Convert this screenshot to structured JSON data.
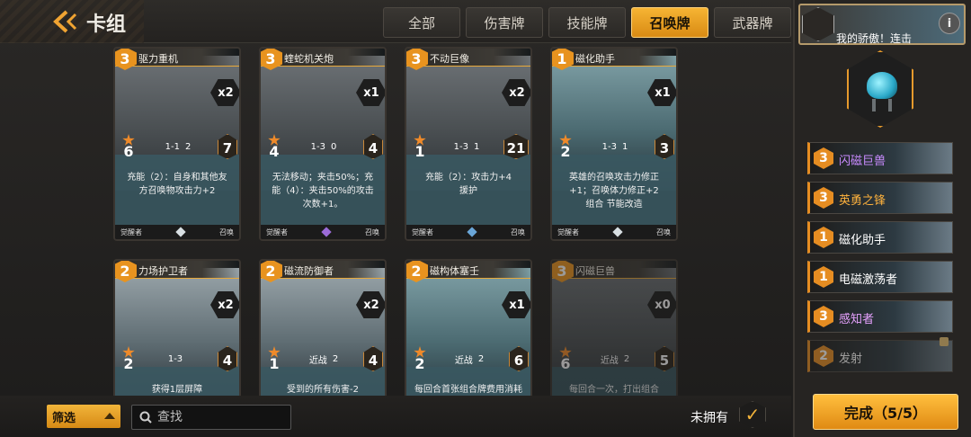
{
  "header": {
    "title": "卡组"
  },
  "tabs": [
    {
      "label": "全部",
      "active": false
    },
    {
      "label": "伤害牌",
      "active": false
    },
    {
      "label": "技能牌",
      "active": false
    },
    {
      "label": "召唤牌",
      "active": true
    },
    {
      "label": "武器牌",
      "active": false
    }
  ],
  "cards": [
    {
      "cost": "3",
      "name": "驱力重机",
      "mult": "x2",
      "atk": "6",
      "range": "1-1",
      "mid": "2",
      "hp": "7",
      "desc": [
        "充能（2）：自身和其他友",
        "方召唤物攻击力+2"
      ],
      "desc_hl": "充能",
      "foot_left": "觉醒者",
      "foot_right": "召唤",
      "gem": "#d8dfe3"
    },
    {
      "cost": "3",
      "name": "蝰蛇机关炮",
      "mult": "x1",
      "atk": "4",
      "range": "1-3",
      "mid": "0",
      "hp": "4",
      "desc": [
        "无法移动；夹击50%；充",
        "能（4）：夹击50%的攻击",
        "次数+1。"
      ],
      "foot_left": "觉醒者",
      "foot_right": "召唤",
      "gem": "#9b6bd8"
    },
    {
      "cost": "3",
      "name": "不动巨像",
      "mult": "x2",
      "atk": "1",
      "range": "1-3",
      "mid": "1",
      "hp": "21",
      "desc": [
        "充能（2）：攻击力+4",
        "援护"
      ],
      "desc_hl": "充能",
      "foot_left": "觉醒者",
      "foot_right": "召唤",
      "gem": "#6aa6d8"
    },
    {
      "cost": "1",
      "name": "磁化助手",
      "mult": "x1",
      "atk": "2",
      "range": "1-3",
      "mid": "1",
      "hp": "3",
      "desc": [
        "英雄的召唤攻击力修正",
        "+1；召唤体力修正+2",
        "组合 节能改造"
      ],
      "foot_left": "觉醒者",
      "foot_right": "召唤",
      "gem": "#d8dfe3"
    },
    {
      "cost": "2",
      "name": "力场护卫者",
      "mult": "x2",
      "atk": "2",
      "range": "1-3",
      "mid": "",
      "hp": "4",
      "desc": [
        "获得1层屏障"
      ],
      "foot_left": "",
      "foot_right": "",
      "gem": ""
    },
    {
      "cost": "2",
      "name": "磁流防御者",
      "mult": "x2",
      "atk": "1",
      "range": "近战",
      "mid": "2",
      "hp": "4",
      "desc": [
        "受到的所有伤害-2"
      ],
      "foot_left": "",
      "foot_right": "",
      "gem": ""
    },
    {
      "cost": "2",
      "name": "磁构体塞壬",
      "mult": "x1",
      "atk": "2",
      "range": "近战",
      "mid": "2",
      "hp": "6",
      "desc": [
        "每回合首张组合牌费用消耗"
      ],
      "foot_left": "",
      "foot_right": "",
      "gem": ""
    },
    {
      "cost": "3",
      "name": "闪磁巨兽",
      "mult": "x0",
      "atk": "6",
      "range": "近战",
      "mid": "2",
      "hp": "5",
      "desc": [
        "每回合一次，打出组合"
      ],
      "foot_left": "",
      "foot_right": "",
      "gem": ""
    }
  ],
  "hero": {
    "text": "我的骄傲！连击",
    "info": "i"
  },
  "deck_list": [
    {
      "cost": "3",
      "name": "闪磁巨兽",
      "style": "purple"
    },
    {
      "cost": "3",
      "name": "英勇之锋",
      "style": "gold"
    },
    {
      "cost": "1",
      "name": "磁化助手",
      "style": "plain"
    },
    {
      "cost": "1",
      "name": "电磁激荡者",
      "style": "plain"
    },
    {
      "cost": "3",
      "name": "感知者",
      "style": "pink"
    },
    {
      "cost": "2",
      "name": "发射",
      "style": "locked"
    }
  ],
  "done_button": "完成（5/5）",
  "filter_label": "筛选",
  "search": {
    "placeholder": "查找"
  },
  "unowned_label": "未拥有",
  "unowned_check": "✓"
}
